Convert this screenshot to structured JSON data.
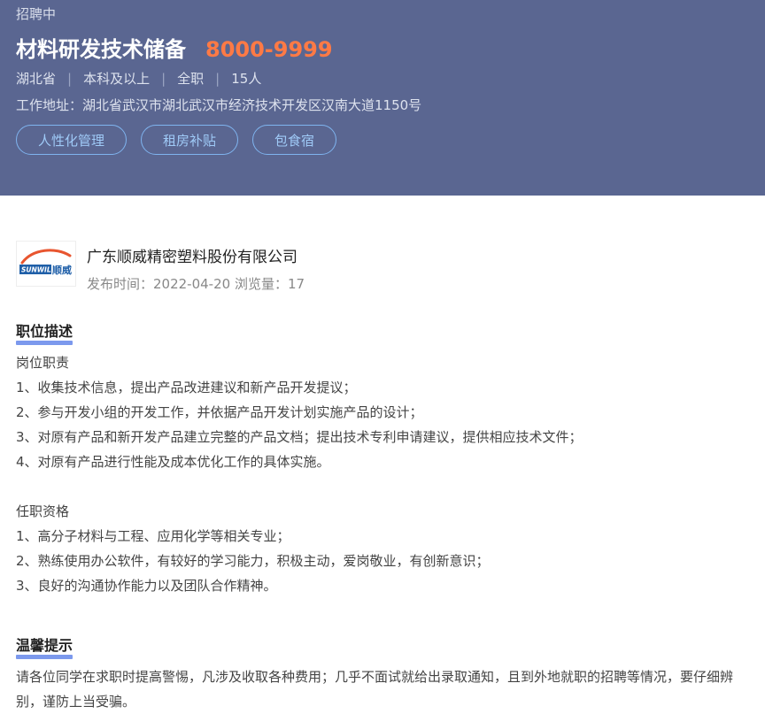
{
  "job": {
    "status": "招聘中",
    "title": "材料研发技术储备",
    "salary": "8000-9999",
    "meta": [
      "湖北省",
      "本科及以上",
      "全职",
      "15人"
    ],
    "meta_separator": "|",
    "address": "工作地址：湖北省武汉市湖北武汉市经济技术开发区汉南大道1150号",
    "tags": [
      "人性化管理",
      "租房补贴",
      "包食宿"
    ]
  },
  "company": {
    "logo_text_en": "SUNWILL",
    "logo_text_cn": "顺威",
    "name": "广东顺威精密塑料股份有限公司",
    "publish_meta": "发布时间：2022-04-20 浏览量：17"
  },
  "description": {
    "heading": "职位描述",
    "duties_title": "岗位职责",
    "duties": [
      "1、收集技术信息，提出产品改进建议和新产品开发提议；",
      "2、参与开发小组的开发工作，并依据产品开发计划实施产品的设计；",
      "3、对原有产品和新开发产品建立完整的产品文档；提出技术专利申请建议，提供相应技术文件；",
      "4、对原有产品进行性能及成本优化工作的具体实施。"
    ],
    "requirements_title": "任职资格",
    "requirements": [
      "1、高分子材料与工程、应用化学等相关专业；",
      "2、熟练使用办公软件，有较好的学习能力，积极主动，爱岗敬业，有创新意识；",
      "3、良好的沟通协作能力以及团队合作精神。"
    ]
  },
  "tips": {
    "heading": "温馨提示",
    "text": "请各位同学在求职时提高警惕，凡涉及收取各种费用；几乎不面试就给出录取通知，且到外地就职的招聘等情况，要仔细辨别，谨防上当受骗。"
  },
  "colors": {
    "header_bg": "#5a6691",
    "salary": "#ff7a45",
    "tag_border": "#7fb4ef",
    "heading_underline": "#5b7fe8"
  }
}
